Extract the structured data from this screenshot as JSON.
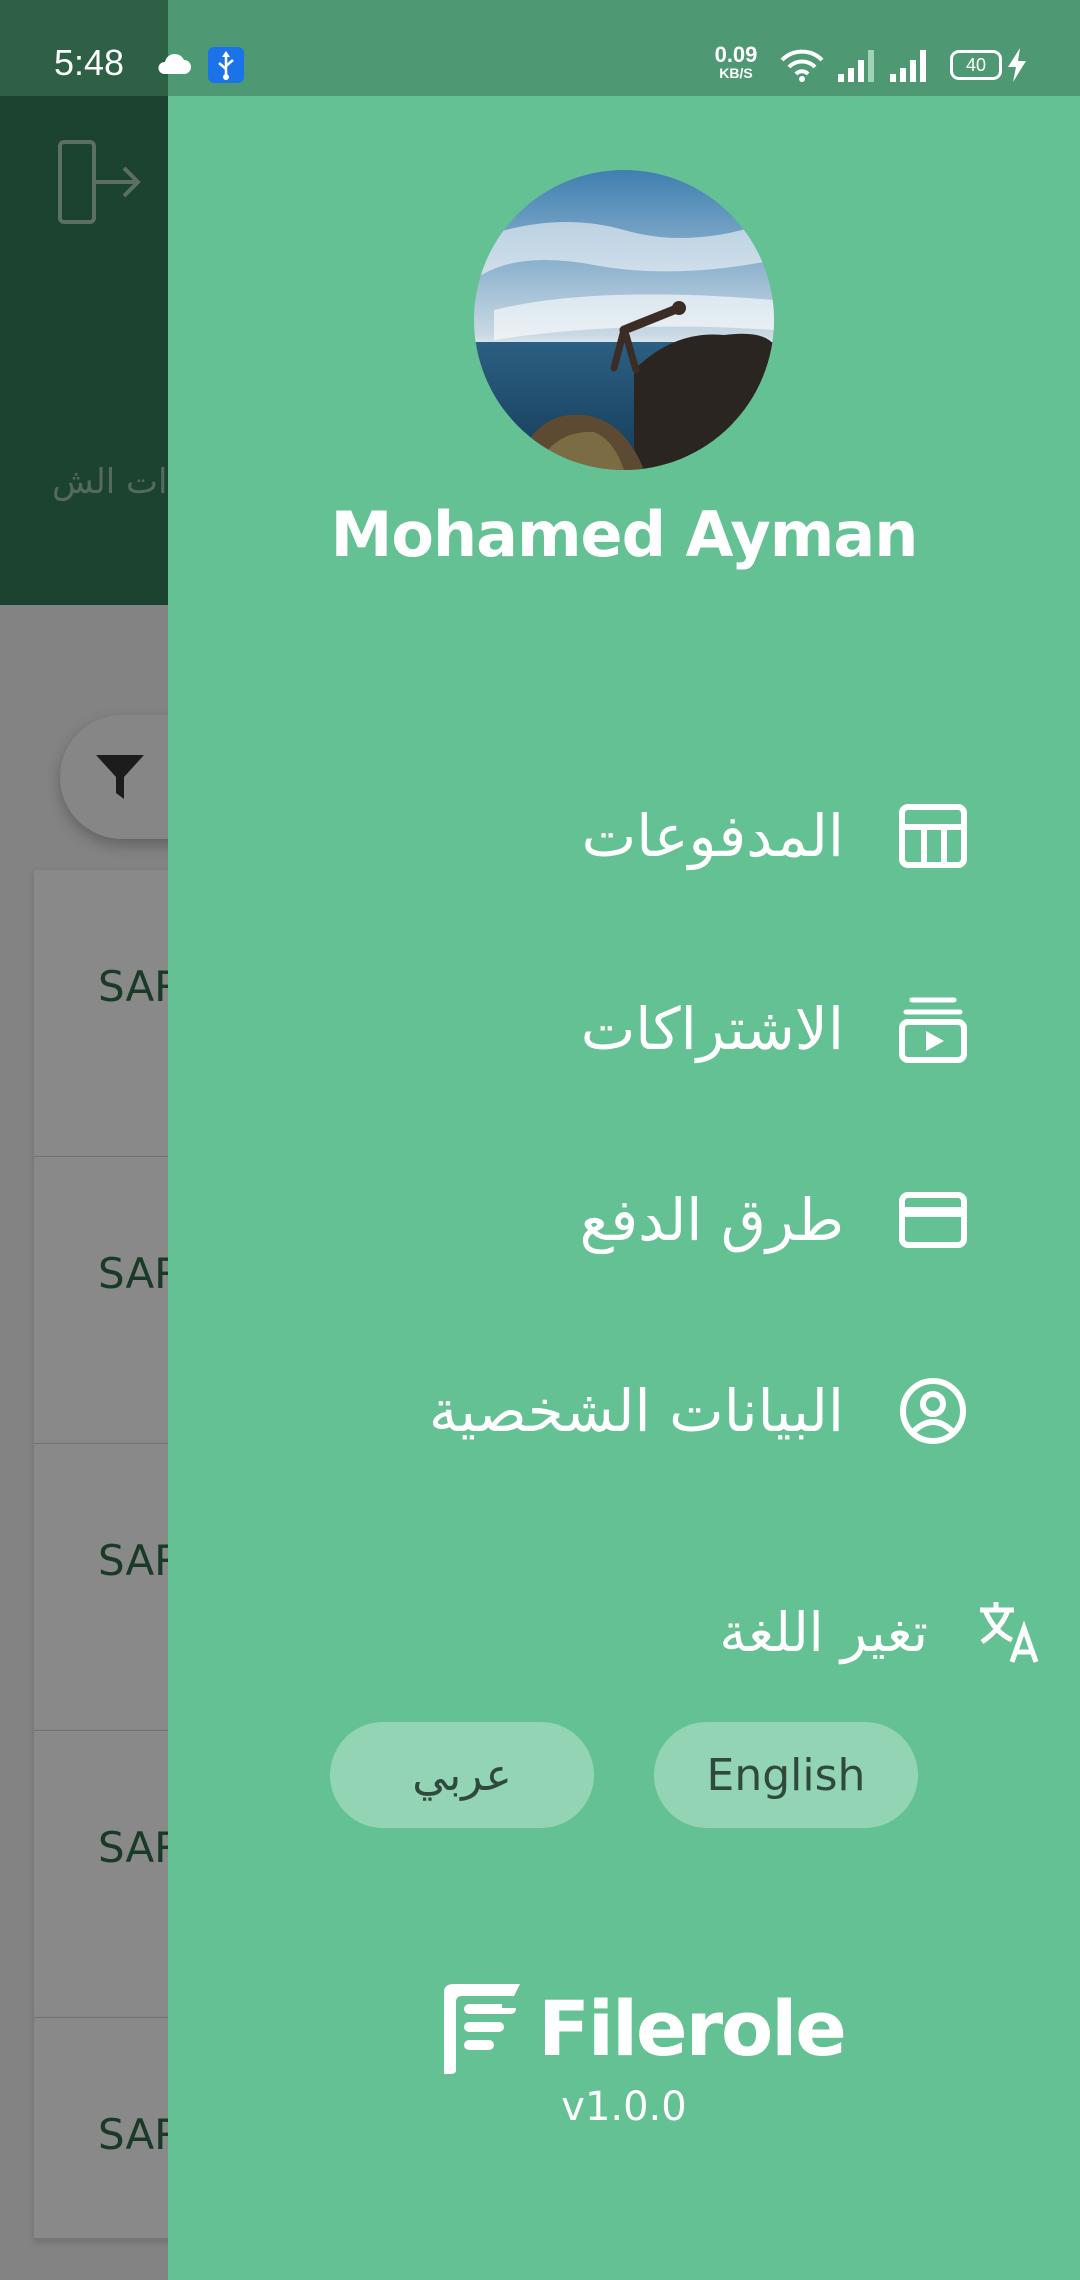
{
  "status_bar": {
    "time": "5:48",
    "net_speed_value": "0.09",
    "net_speed_unit": "KB/S",
    "battery": "40",
    "icons": [
      "cloud-icon",
      "usb-icon",
      "wifi-icon",
      "signal-icon",
      "signal-icon",
      "battery-icon",
      "charging-bolt-icon"
    ]
  },
  "background": {
    "header_title_partial": "ات الش",
    "exit_icon": "logout-icon",
    "filter_icon": "filter-icon",
    "rows": [
      "SAR",
      "SAR",
      "SAR",
      "SAR",
      "SAR"
    ]
  },
  "drawer": {
    "user_name": "Mohamed Ayman",
    "menu": [
      {
        "label": "المدفوعات",
        "icon": "table-icon"
      },
      {
        "label": "الاشتراكات",
        "icon": "subscriptions-icon"
      },
      {
        "label": "طرق الدفع",
        "icon": "credit-card-icon"
      },
      {
        "label": "البيانات الشخصية",
        "icon": "account-circle-icon"
      }
    ],
    "language": {
      "label": "تغير اللغة",
      "icon": "translate-icon",
      "arabic_button": "عربي",
      "english_button": "English"
    },
    "brand_name": "Filerole",
    "version": "v1.0.0"
  },
  "colors": {
    "drawer_bg": "#64c194",
    "header_bg": "#337a57",
    "lang_button_bg": "#92d4b3"
  }
}
